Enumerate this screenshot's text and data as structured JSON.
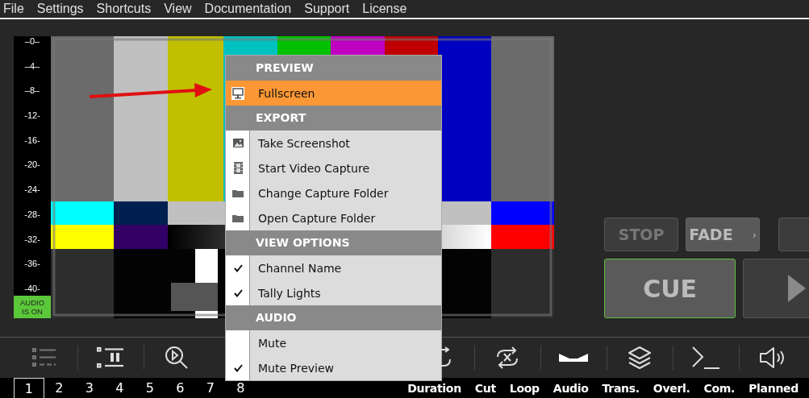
{
  "menu_bar": [
    {
      "label": "File"
    },
    {
      "label": "Settings"
    },
    {
      "label": "Shortcuts"
    },
    {
      "label": "View"
    },
    {
      "label": "Documentation"
    },
    {
      "label": "Support"
    },
    {
      "label": "License"
    }
  ],
  "audio_meter": {
    "scale": [
      "–0–",
      "–4–",
      "–8–",
      "-12-",
      "-16-",
      "-20-",
      "-24-",
      "-28-",
      "-32-",
      "-36-",
      "-40-"
    ],
    "badge": {
      "label": "AUDIO IS ON",
      "on": true
    }
  },
  "context_menu": {
    "sections": [
      {
        "title": "PREVIEW",
        "items": [
          {
            "label": "Fullscreen",
            "kind": "fullscreen",
            "selected": true
          }
        ]
      },
      {
        "title": "EXPORT",
        "items": [
          {
            "label": "Take Screenshot",
            "kind": "screenshot",
            "selected": false
          },
          {
            "label": "Start Video Capture",
            "kind": "video",
            "selected": false
          },
          {
            "label": "Change Capture Folder",
            "kind": "folder",
            "selected": false
          },
          {
            "label": "Open Capture Folder",
            "kind": "folder",
            "selected": false
          }
        ]
      },
      {
        "title": "VIEW OPTIONS",
        "items": [
          {
            "label": "Channel Name",
            "kind": "toggle",
            "checked": true,
            "selected": false
          },
          {
            "label": "Tally Lights",
            "kind": "toggle",
            "checked": true,
            "selected": false
          }
        ]
      },
      {
        "title": "AUDIO",
        "items": [
          {
            "label": "Mute",
            "kind": "toggle",
            "checked": false,
            "selected": false
          },
          {
            "label": "Mute Preview",
            "kind": "toggle",
            "checked": true,
            "selected": false
          }
        ]
      }
    ]
  },
  "transport": {
    "buttons": [
      {
        "label": "STOP",
        "disabled": true
      },
      {
        "label": "FADE",
        "disabled": false,
        "chevron": "›"
      }
    ],
    "cue": {
      "label": "CUE",
      "armed": true
    }
  },
  "channels": [
    {
      "label": "1",
      "selected": true
    },
    {
      "label": "2",
      "selected": false
    },
    {
      "label": "3",
      "selected": false
    },
    {
      "label": "4",
      "selected": false
    },
    {
      "label": "5",
      "selected": false
    },
    {
      "label": "6",
      "selected": false
    },
    {
      "label": "7",
      "selected": false
    },
    {
      "label": "8",
      "selected": false
    }
  ],
  "toolbar_labels": [
    "Duration",
    "Cut",
    "Loop",
    "Audio",
    "Trans.",
    "Overl.",
    "Com.",
    "Planned"
  ]
}
